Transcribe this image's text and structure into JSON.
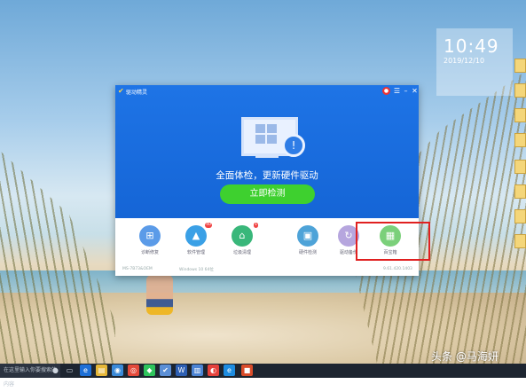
{
  "app": {
    "title": "驱动精灵",
    "headline": "全面体检，更新硬件驱动",
    "scan_button": "立即检测",
    "tools": [
      {
        "label": "诊断修复",
        "icon": "repair-icon",
        "color": "#5b9be8",
        "badge": ""
      },
      {
        "label": "软件管理",
        "icon": "software-icon",
        "color": "#3aa0e6",
        "badge": "40"
      },
      {
        "label": "垃圾清理",
        "icon": "clean-icon",
        "color": "#39b77a",
        "badge": "1"
      },
      {
        "label": "硬件检测",
        "icon": "hardware-icon",
        "color": "#4ea3d8",
        "badge": ""
      },
      {
        "label": "驱动备份",
        "icon": "backup-icon",
        "color": "#b6a6de",
        "badge": ""
      },
      {
        "label": "百宝箱",
        "icon": "toolbox-icon",
        "color": "#7bd07a",
        "badge": ""
      }
    ],
    "status_left": "MS-7B73&OEM",
    "status_mid": "Windows 10 64位",
    "status_right": "9.61.420.1403"
  },
  "desktop": {
    "clock_time": "10:49",
    "clock_date": "2019/12/10",
    "watermark": "头条 @马海妍"
  },
  "taskbar": {
    "search_placeholder": "在这里输入你要搜索的内容"
  },
  "colors": {
    "header_blue": "#1a6ee0",
    "scan_green": "#3ed02f",
    "highlight_red": "#e02020"
  }
}
